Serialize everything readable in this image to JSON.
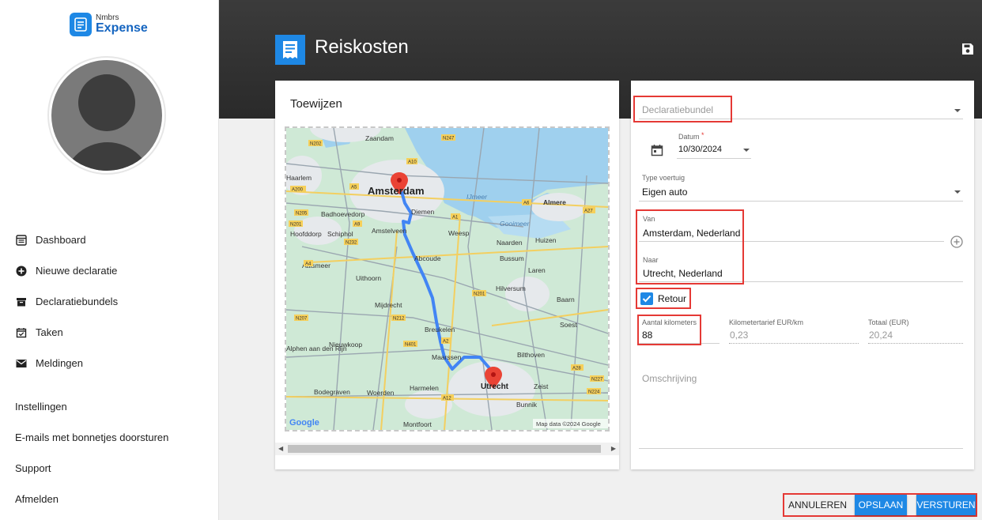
{
  "app": {
    "logo_small": "Nmbrs",
    "logo_big": "Expense"
  },
  "sidebar": {
    "items": [
      {
        "label": "Dashboard",
        "icon": "dashboard-icon"
      },
      {
        "label": "Nieuwe declaratie",
        "icon": "add-circle-icon"
      },
      {
        "label": "Declaratiebundels",
        "icon": "archive-icon"
      },
      {
        "label": "Taken",
        "icon": "calendar-check-icon"
      },
      {
        "label": "Meldingen",
        "icon": "mail-icon"
      }
    ],
    "links": [
      "Instellingen",
      "E-mails met bonnetjes doorsturen",
      "Support",
      "Afmelden"
    ]
  },
  "header": {
    "title": "Reiskosten"
  },
  "assign": {
    "title": "Toewijzen",
    "map": {
      "places": [
        "Zaandam",
        "Amsterdam",
        "Almere",
        "Haarlem",
        "Badhoevedorp",
        "Diemen",
        "Weesp",
        "Hoofddorp",
        "Schiphol",
        "Amstelveen",
        "Naarden",
        "Huizen",
        "Aalsmeer",
        "Abcoude",
        "Bussum",
        "Laren",
        "Uithoorn",
        "Hilversum",
        "Baarn",
        "Mijdrecht",
        "Breukelen",
        "Soest",
        "Nieuwkoop",
        "Alphen aan den Rijn",
        "Maarssen",
        "Bilthoven",
        "Bodegraven",
        "Woerden",
        "Harmelen",
        "Utrecht",
        "Zeist",
        "Bunnik",
        "Montfoort"
      ],
      "water": [
        "IJmeer",
        "Gooimeer"
      ],
      "roads": [
        "N202",
        "N247",
        "A10",
        "A5",
        "A200",
        "N205",
        "N201",
        "A9",
        "A1",
        "A4",
        "N232",
        "A6",
        "A27",
        "N207",
        "N212",
        "N401",
        "A2",
        "N201",
        "A28",
        "N227",
        "N224",
        "A12"
      ],
      "attribution": "Map data ©2024 Google",
      "logo": "Google"
    }
  },
  "form": {
    "bundle_placeholder": "Declaratiebundel",
    "date_label": "Datum",
    "date_required": "*",
    "date_value": "10/30/2024",
    "vehicle_label": "Type voertuig",
    "vehicle_value": "Eigen auto",
    "from_label": "Van",
    "from_value": "Amsterdam, Nederland",
    "to_label": "Naar",
    "to_value": "Utrecht, Nederland",
    "retour_label": "Retour",
    "retour_checked": true,
    "km_label": "Aantal kilometers",
    "km_value": "88",
    "rate_label": "Kilometertarief EUR/km",
    "rate_value": "0,23",
    "total_label": "Totaal (EUR)",
    "total_value": "20,24",
    "description_placeholder": "Omschrijving"
  },
  "actions": {
    "cancel": "ANNULEREN",
    "save": "OPSLAAN",
    "send": "VERSTUREN"
  },
  "colors": {
    "accent": "#1e88e5",
    "highlight": "#e53935",
    "header": "#333333"
  }
}
